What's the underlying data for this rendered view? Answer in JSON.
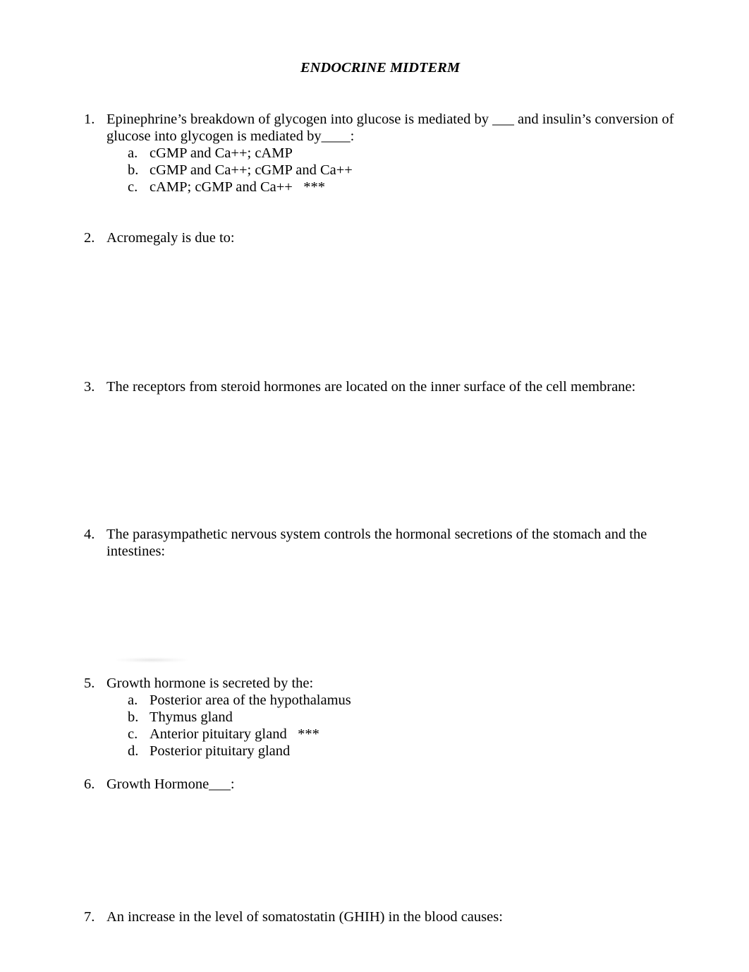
{
  "document": {
    "title": "ENDOCRINE MIDTERM",
    "questions": [
      {
        "number": "1.",
        "text": "Epinephrine’s breakdown of glycogen into glucose is mediated by ___ and insulin’s conversion of glucose into glycogen is mediated by____:",
        "options": [
          {
            "letter": "a.",
            "text": "cGMP and Ca++; cAMP"
          },
          {
            "letter": "b.",
            "text": "cGMP and Ca++; cGMP and Ca++"
          },
          {
            "letter": "c.",
            "text": "cAMP; cGMP and Ca++   ***"
          }
        ]
      },
      {
        "number": "2.",
        "text": "Acromegaly is due to:"
      },
      {
        "number": "3.",
        "text": "The receptors from steroid hormones are located on the inner surface of the cell membrane:"
      },
      {
        "number": "4.",
        "text": "The parasympathetic nervous system controls the hormonal secretions of the stomach and the intestines:"
      },
      {
        "number": "5.",
        "text": "Growth hormone is secreted by the:",
        "options": [
          {
            "letter": "a.",
            "text": "Posterior area of the hypothalamus"
          },
          {
            "letter": "b.",
            "text": "Thymus gland"
          },
          {
            "letter": "c.",
            "text": "Anterior pituitary gland   ***"
          },
          {
            "letter": "d.",
            "text": "Posterior pituitary gland"
          }
        ]
      },
      {
        "number": "6.",
        "text": "Growth Hormone___:"
      },
      {
        "number": "7.",
        "text": "An increase in the level of somatostatin (GHIH) in the blood causes:"
      }
    ]
  }
}
